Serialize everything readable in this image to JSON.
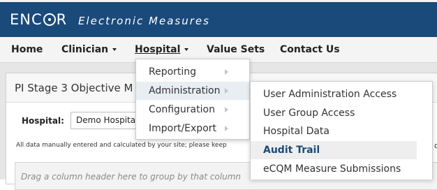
{
  "header": {
    "logo_left": "ENC",
    "logo_right": "R",
    "product": "Electronic Measures"
  },
  "nav": {
    "items": [
      {
        "label": "Home"
      },
      {
        "label": "Clinician"
      },
      {
        "label": "Hospital"
      },
      {
        "label": "Value Sets"
      },
      {
        "label": "Contact Us"
      }
    ]
  },
  "panel": {
    "title": "PI Stage 3 Objective M",
    "hospital_label": "Hospital:",
    "hospital_value": "Demo Hospita",
    "notice": "All data manually entered and calculated by your site; please keep",
    "group_hint": "Drag a column header here to group by that column",
    "edge_char": "of"
  },
  "hospital_menu": {
    "items": [
      {
        "label": "Reporting"
      },
      {
        "label": "Administration"
      },
      {
        "label": "Configuration"
      },
      {
        "label": "Import/Export"
      }
    ]
  },
  "admin_submenu": {
    "items": [
      {
        "label": "User Administration Access"
      },
      {
        "label": "User Group Access"
      },
      {
        "label": "Hospital Data"
      },
      {
        "label": "Audit Trail"
      },
      {
        "label": "eCQM Measure Submissions"
      }
    ]
  }
}
